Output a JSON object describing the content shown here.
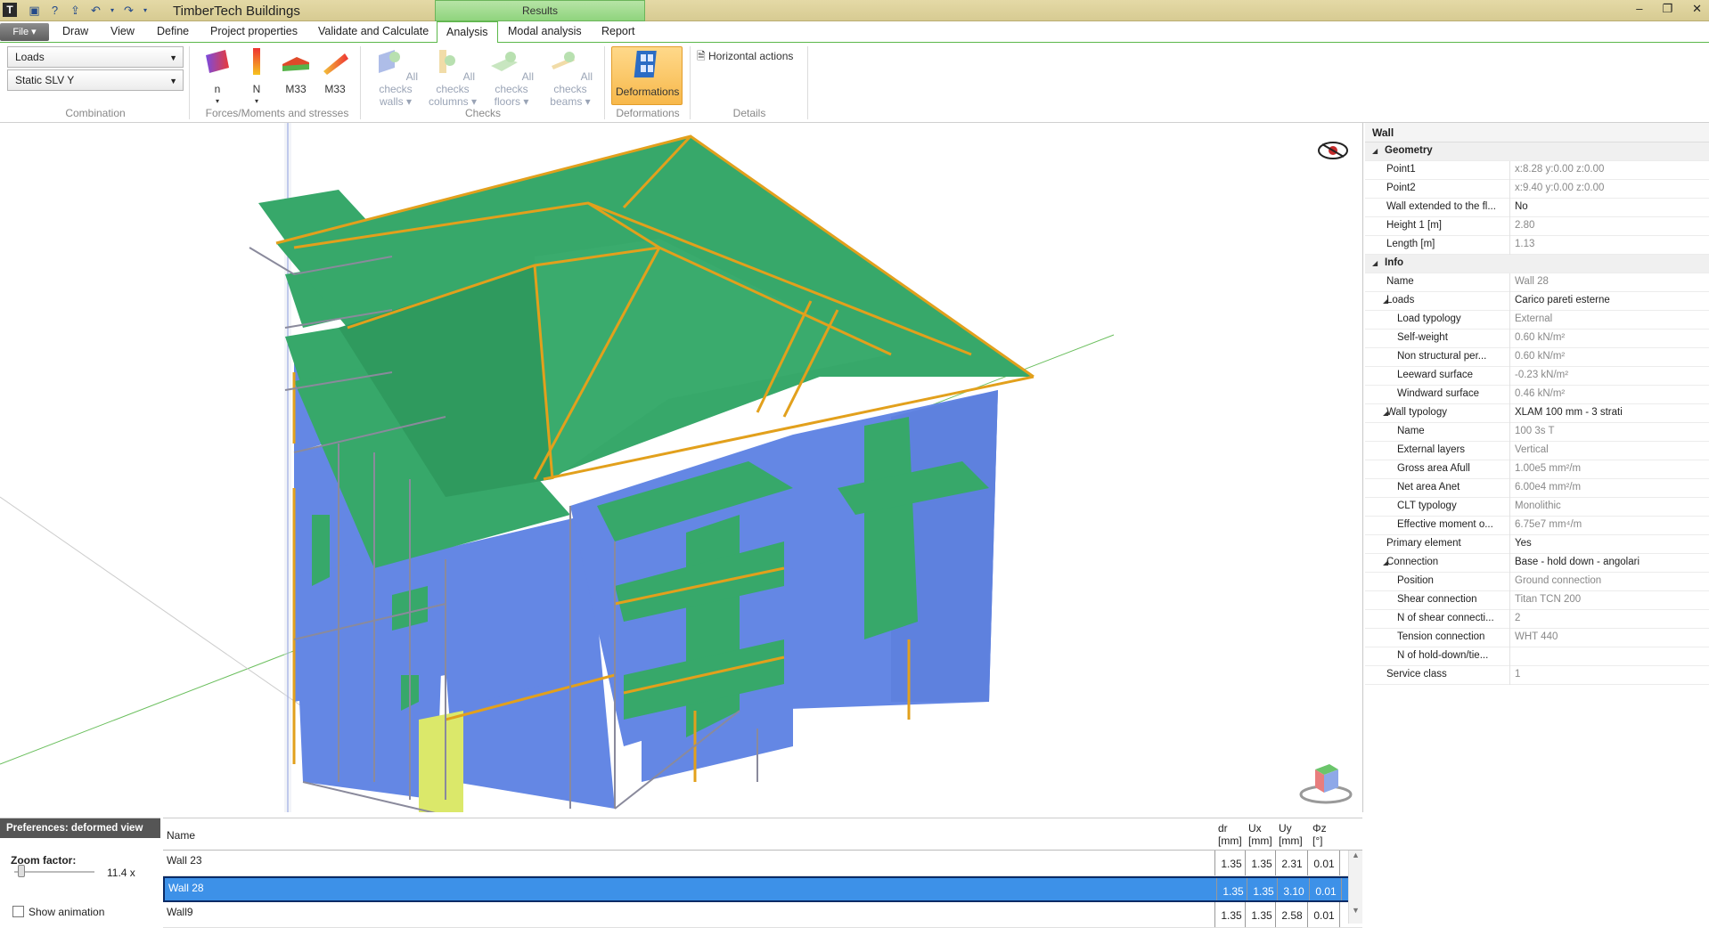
{
  "app": {
    "title": "TimberTech Buildings",
    "context_tab": "Results"
  },
  "ribbon_tabs": [
    "Draw",
    "View",
    "Define",
    "Project properties",
    "Validate and Calculate",
    "Analysis",
    "Modal analysis",
    "Report"
  ],
  "file_label": "File",
  "active_tab": "Analysis",
  "combination": {
    "load_value": "Loads",
    "case_value": "Static SLV Y",
    "group_label": "Combination"
  },
  "forces": {
    "buttons": [
      "n",
      "N",
      "M33",
      "M33"
    ],
    "group_label": "Forces/Moments and stresses"
  },
  "checks": {
    "buttons": [
      {
        "line1": "All checks",
        "line2": "walls"
      },
      {
        "line1": "All checks",
        "line2": "columns"
      },
      {
        "line1": "All checks",
        "line2": "floors"
      },
      {
        "line1": "All checks",
        "line2": "beams"
      }
    ],
    "group_label": "Checks"
  },
  "deformations": {
    "button": "Deformations",
    "group_label": "Deformations"
  },
  "details": {
    "button": "Horizontal actions",
    "group_label": "Details"
  },
  "panel": {
    "title": "Wall",
    "rows": [
      {
        "type": "cat",
        "key": "Geometry"
      },
      {
        "key": "Point1",
        "value": "x:8.28 y:0.00 z:0.00"
      },
      {
        "key": "Point2",
        "value": "x:9.40 y:0.00 z:0.00"
      },
      {
        "key": "Wall extended to the fl...",
        "value": "No",
        "dark": true
      },
      {
        "key": "Height 1 [m]",
        "value": "2.80"
      },
      {
        "key": "Length [m]",
        "value": "1.13"
      },
      {
        "type": "cat",
        "key": "Info"
      },
      {
        "key": "Name",
        "value": "Wall 28"
      },
      {
        "key": "Loads",
        "value": "Carico pareti esterne",
        "dark": true,
        "sub": true
      },
      {
        "key": "Load typology",
        "value": "External",
        "indent": true
      },
      {
        "key": "Self-weight",
        "value": "0.60 kN/m²",
        "indent": true
      },
      {
        "key": "Non structural per...",
        "value": "0.60 kN/m²",
        "indent": true
      },
      {
        "key": "Leeward surface",
        "value": "-0.23 kN/m²",
        "indent": true
      },
      {
        "key": "Windward surface",
        "value": "0.46 kN/m²",
        "indent": true
      },
      {
        "key": "Wall typology",
        "value": "XLAM 100 mm - 3 strati",
        "dark": true,
        "sub": true
      },
      {
        "key": "Name",
        "value": "100 3s T",
        "indent": true
      },
      {
        "key": "External layers",
        "value": "Vertical",
        "indent": true
      },
      {
        "key": "Gross area Afull",
        "value": "1.00e5 mm²/m",
        "indent": true
      },
      {
        "key": "Net area Anet",
        "value": "6.00e4 mm²/m",
        "indent": true
      },
      {
        "key": "CLT typology",
        "value": "Monolithic",
        "indent": true
      },
      {
        "key": "Effective moment o...",
        "value": "6.75e7 mm⁴/m",
        "indent": true
      },
      {
        "key": "Primary element",
        "value": "Yes",
        "dark": true
      },
      {
        "key": "Connection",
        "value": "Base - hold down - angolari",
        "dark": true,
        "sub": true
      },
      {
        "key": "Position",
        "value": "Ground connection",
        "indent": true
      },
      {
        "key": "Shear connection",
        "value": "Titan TCN 200",
        "indent": true
      },
      {
        "key": "N of shear connecti...",
        "value": "2",
        "indent": true
      },
      {
        "key": "Tension connection",
        "value": "WHT 440",
        "indent": true
      },
      {
        "key": "N of hold-down/tie...",
        "value": "",
        "indent": true
      },
      {
        "key": "Service class",
        "value": "1"
      }
    ]
  },
  "prefs": {
    "header": "Preferences: deformed view",
    "zoom_label": "Zoom factor:",
    "zoom_value": "11.4 x",
    "animation_label": "Show animation"
  },
  "results_grid": {
    "name_header": "Name",
    "columns": [
      {
        "top": "dr",
        "unit": "[mm]"
      },
      {
        "top": "Ux",
        "unit": "[mm]"
      },
      {
        "top": "Uy",
        "unit": "[mm]"
      },
      {
        "top": "Φz",
        "unit": "[°]"
      }
    ],
    "rows": [
      {
        "name": "Wall 23",
        "values": [
          "1.35",
          "1.35",
          "2.31",
          "0.01"
        ]
      },
      {
        "name": "Wall 28",
        "values": [
          "1.35",
          "1.35",
          "3.10",
          "0.01"
        ],
        "selected": true
      },
      {
        "name": "Wall9",
        "values": [
          "1.35",
          "1.35",
          "2.58",
          "0.01"
        ]
      }
    ]
  },
  "colors": {
    "wall": "#6487e4",
    "floor": "#37a86a",
    "beam": "#e2a01c",
    "edge": "#8a8a9c",
    "selection": "#3d91e8"
  }
}
